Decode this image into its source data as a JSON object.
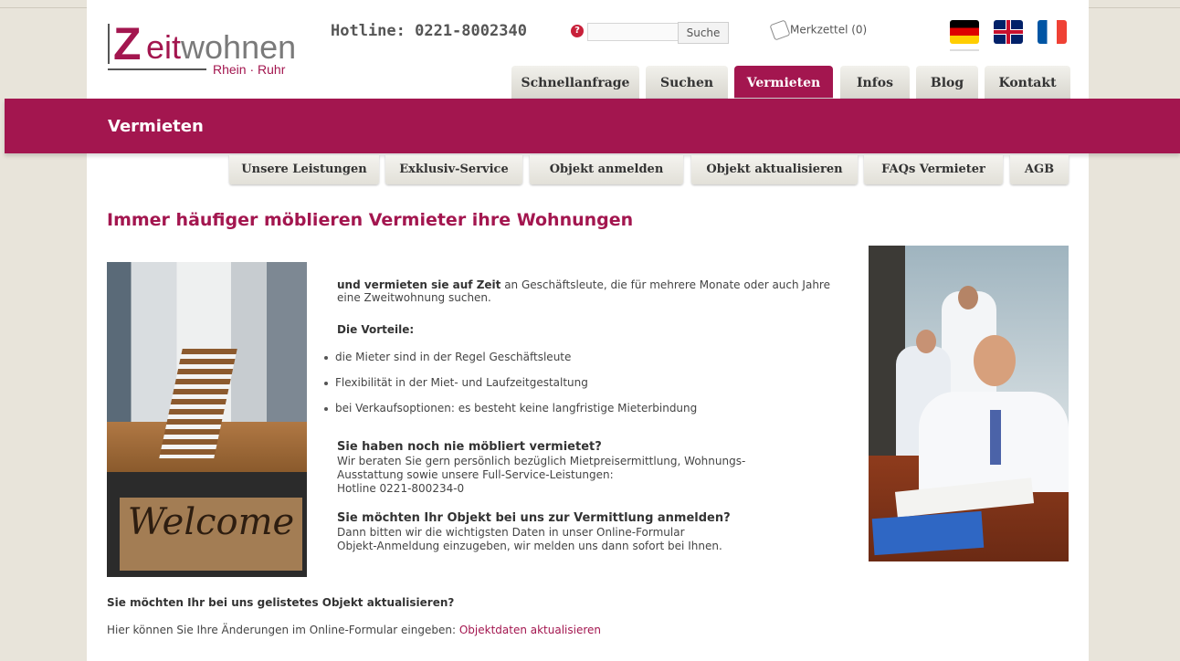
{
  "header": {
    "logo_z": "Z",
    "logo_eit": "eit",
    "logo_wohnen": "wohnen",
    "logo_sub": "Rhein · Ruhr",
    "hotline": "Hotline: 0221-8002340",
    "search": {
      "placeholder": "",
      "button_label": "Suche"
    },
    "merkzettel": "Merkzettel (0)",
    "languages": [
      "de",
      "en",
      "fr"
    ]
  },
  "main_nav": {
    "tabs": [
      {
        "label": "Schnellanfrage",
        "active": false
      },
      {
        "label": "Suchen",
        "active": false
      },
      {
        "label": "Vermieten",
        "active": true
      },
      {
        "label": "Infos",
        "active": false
      },
      {
        "label": "Blog",
        "active": false
      },
      {
        "label": "Kontakt",
        "active": false
      }
    ]
  },
  "banner": {
    "title": "Vermieten"
  },
  "sub_nav": {
    "tabs": [
      {
        "label": "Unsere Leistungen"
      },
      {
        "label": "Exklusiv-Service"
      },
      {
        "label": "Objekt anmelden"
      },
      {
        "label": "Objekt aktualisieren"
      },
      {
        "label": "FAQs Vermieter"
      },
      {
        "label": "AGB"
      }
    ]
  },
  "content": {
    "heading": "Immer häufiger möblieren Vermieter ihre Wohnungen",
    "intro_bold": "und vermieten sie auf Zeit",
    "intro_line1": " an Geschäftsleute, die für mehrere Monate oder auch Jahre",
    "intro_line2": "eine Zweitwohnung suchen.",
    "advantages_title": "Die Vorteile:",
    "advantages": [
      "die Mieter sind in der Regel Geschäftsleute",
      "Flexibilität in der Miet- und Laufzeitgestaltung",
      "bei Verkaufsoptionen: es besteht keine langfristige Mieterbindung"
    ],
    "section1_title": "Sie haben noch nie möbliert vermietet?",
    "section1_lines": [
      "Wir beraten  Sie gern persönlich bezüglich  Mietpreisermittlung, Wohnungs-",
      "Ausstattung sowie unsere Full-Service-Leistungen:",
      "Hotline  0221-800234-0"
    ],
    "section2_title": "Sie möchten Ihr Objekt bei uns zur Vermittlung anmelden?",
    "section2_lines": [
      "Dann bitten wir die wichtigsten Daten in unser Online-Formular",
      "Objekt-Anmeldung einzugeben, wir melden uns dann sofort bei Ihnen."
    ],
    "bottom_title": "Sie möchten Ihr bei uns gelistetes Objekt aktualisieren?",
    "bottom_text": "Hier können Sie Ihre Änderungen im Online-Formular eingeben: ",
    "bottom_link": "Objektdaten aktualisieren",
    "welcome_mat_text": "Welcome"
  },
  "colors": {
    "brand": "#a3164f"
  }
}
